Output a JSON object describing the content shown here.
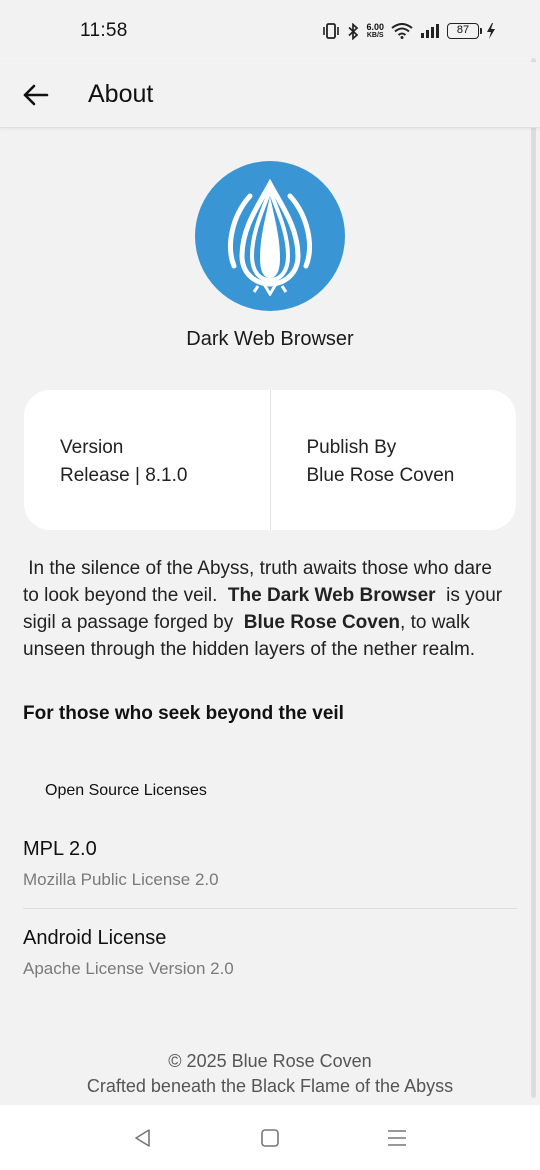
{
  "status_bar": {
    "time": "11:58",
    "net_speed_value": "6.00",
    "net_speed_unit": "KB/S",
    "battery_level": "87"
  },
  "app_bar": {
    "title": "About"
  },
  "app": {
    "name": "Dark Web Browser",
    "logo_color": "#3a95d4"
  },
  "info": {
    "version_label": "Version",
    "version_value": "Release | 8.1.0",
    "publisher_label": "Publish By",
    "publisher_value": "Blue Rose Coven"
  },
  "description": {
    "part1": " In the silence of the Abyss, truth awaits those who dare to look beyond the veil.  ",
    "bold1": "The Dark Web Browser",
    "part2": "  is your sigil a passage forged by  ",
    "bold2": "Blue Rose Coven",
    "part3": ", to walk unseen through the hidden layers of the nether realm."
  },
  "tagline": "For those who seek beyond the veil",
  "licenses": {
    "header": "Open Source Licenses",
    "items": [
      {
        "title": "MPL 2.0",
        "subtitle": "Mozilla Public License 2.0"
      },
      {
        "title": "Android License",
        "subtitle": "Apache License Version 2.0"
      }
    ]
  },
  "footer": {
    "copyright": "© 2025 Blue Rose Coven",
    "crafted": "Crafted beneath the Black Flame of the Abyss"
  },
  "nav": {
    "back": "back-icon",
    "home": "home-icon",
    "recents": "menu-icon"
  }
}
